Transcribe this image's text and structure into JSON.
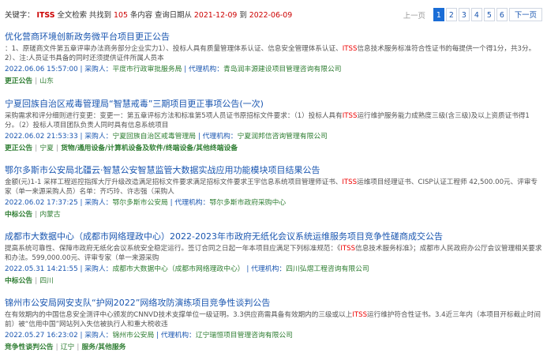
{
  "summary": {
    "label": "关键字：",
    "keyword": "ITSS",
    "mid1": "全文检索 共找到",
    "count": "105",
    "mid2": "条内容 查询日期从",
    "date_from": "2021-12-09",
    "to": "到",
    "date_to": "2022-06-09"
  },
  "pager": {
    "prev": "上一页",
    "pages": [
      "1",
      "2",
      "3",
      "4",
      "5",
      "6"
    ],
    "next": "下一页"
  },
  "results": [
    {
      "title": "优化营商环境创新政务微平台项目更正公告",
      "desc_a": "：1、原磋商文件第五章评审办法商务部分企业实力1）、投标人具有质量管理体系认证、信息安全管理体系认证、",
      "desc_hl": "ITSS",
      "desc_b": "信息技术服务标准符合性证书的每提供一个得1分，共3分。2）、注:人员证书具备的同时还须提供证件所属人员本",
      "date": "2022.06.06 15:57:00",
      "buyer_label": "采购人：",
      "buyer": "平度市行政审批服务局",
      "agent_label": "代理机构：",
      "agent": "青岛润丰源建设项目管理咨询有限公司",
      "type": "更正公告",
      "region": "山东",
      "category": ""
    },
    {
      "title": "宁夏回族自治区戒毒管理局“智慧戒毒”三期项目更正事项公告(一次)",
      "desc_a": "采购需求和评分细则进行变更：变更一：第五章评标方法和标准第5项人员证书原招标文件要求：（1）投标人具有",
      "desc_hl": "ITSS",
      "desc_b": "运行维护服务能力成熟度三级(含三级)及以上资质证书得1分。（2）投标人项目团队负责人同时具有信息系统项目",
      "date": "2022.06.02 21:53:33",
      "buyer_label": "采购人：",
      "buyer": "宁夏回族自治区戒毒管理局",
      "agent_label": "代理机构：",
      "agent": "宁夏润邦信咨询管理有限公司",
      "type": "更正公告",
      "region": "宁夏",
      "category": "货物/通用设备/计算机设备及软件/终端设备/其他终端设备"
    },
    {
      "title": "鄂尔多斯市公安局北疆云·智慧公安智慧监管大数据实战应用功能模块项目结果公告",
      "desc_a": "金额(元)1-1 采样工程巡控指挥大厅升级改造满足招标文件要求满足招标文件要求王宇信息系统项目管理师证书、",
      "desc_hl": "ITSS",
      "desc_b": "运维项目经理证书、CISP认证工程师 42,500.00元、评审专家（单一来源采购人员）名单：齐巧玲、许志强（采购人",
      "date": "2022.06.02 17:37:25",
      "buyer_label": "采购人：",
      "buyer": "鄂尔多斯市公安局",
      "agent_label": "代理机构：",
      "agent": "鄂尔多斯市政府采购中心",
      "type": "中标公告",
      "region": "内蒙古",
      "category": ""
    },
    {
      "title": "成都市大数据中心（成都市网络理政中心）2022-2023年市政府无纸化会议系统运维服务项目竞争性磋商成交公告",
      "desc_a": "提高系统可靠性、保障市政府无纸化会议系统安全稳定运行。签订合同之日起一年本项目应满足下列标准规范：《",
      "desc_hl": "ITSS",
      "desc_b": "信息技术服务标准》；成都市人民政府办公厅会议管理相关要求和办法。599,000.00元、评审专家（单一来源采购",
      "date": "2022.05.31 14:21:55",
      "buyer_label": "采购人：",
      "buyer": "成都市大数据中心（成都市网络理政中心）",
      "agent_label": "代理机构：",
      "agent": "四川弘熠工程咨询有限公司",
      "type": "中标公告",
      "region": "四川",
      "category": ""
    },
    {
      "title": "锦州市公安局网安支队“护网2022”网络攻防演练项目竞争性谈判公告",
      "desc_a": "在有效期内的中国信息安全测评中心颁发的CNNVD技术支撑单位一级证明。3.3供应商需具备有效期内的三级或以上",
      "desc_hl": "ITSS",
      "desc_b": "运行维护符合性证书。3.4近三年内（本项目开标截止时间前）被“信用中国”网站列入失信被执行人和重大税收违",
      "date": "2022.05.27 16:23:02",
      "buyer_label": "采购人：",
      "buyer": "锦州市公安局",
      "agent_label": "代理机构：",
      "agent": "辽宁瑞恒项目管理咨询有限公司",
      "type": "竞争性谈判公告",
      "region": "辽宁",
      "category": "服务/其他服务"
    }
  ]
}
